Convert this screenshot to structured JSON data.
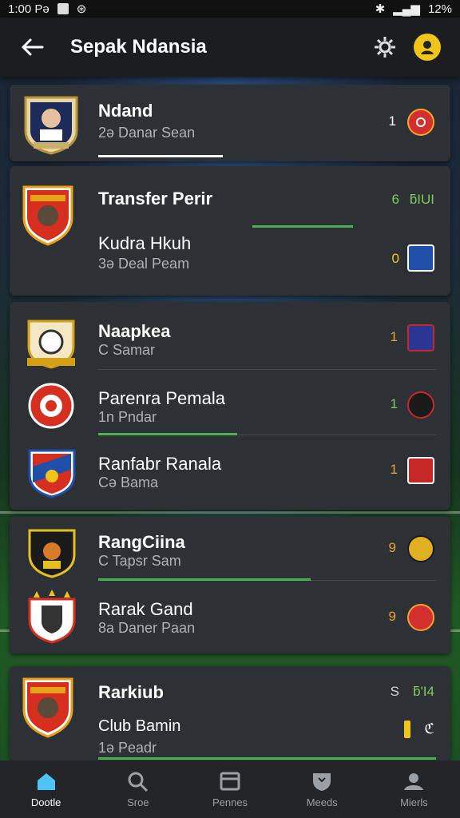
{
  "status": {
    "time": "1:00 Pǝ",
    "battery": "12%"
  },
  "header": {
    "title": "Sepak Ndansia"
  },
  "cards": [
    {
      "rows": [
        {
          "name": "Ndand",
          "sub": "2ə Danar Sean",
          "score": "1",
          "score_color": "#ffffff",
          "badge_color": "#d32f2f"
        }
      ]
    },
    {
      "rows": [
        {
          "name": "Transfer Perir",
          "sub": "",
          "score": "6",
          "score_color": "#7ecb5c",
          "extra": "ƃIUI",
          "badge_color": ""
        },
        {
          "name": "Kudra Hkuh",
          "sub": "3ə Deal Peam",
          "score": "0",
          "score_color": "#f0c419",
          "badge_color": "#1f4fa8"
        }
      ]
    },
    {
      "rows": [
        {
          "name": "Naapkea",
          "sub": "C Samar",
          "score": "1",
          "score_color": "#f0a030",
          "badge_color": "#283593"
        },
        {
          "name": "Parenra Pemala",
          "sub": "1n Pndar",
          "score": "1",
          "score_color": "#7ecb5c",
          "badge_color": "#1a1a1a"
        },
        {
          "name": "Ranfabr Ranala",
          "sub": "Cə Bama",
          "score": "1",
          "score_color": "#f0a030",
          "badge_color": "#c62828"
        }
      ]
    },
    {
      "rows": [
        {
          "name": "RangCiina",
          "sub": "C Tapsr Sam",
          "score": "9",
          "score_color": "#f0a030",
          "badge_color": "#e0b020"
        },
        {
          "name": "Rarak Gand",
          "sub": "8a Daner Paan",
          "score": "9",
          "score_color": "#f0a030",
          "badge_color": "#d32f2f"
        }
      ]
    },
    {
      "rows": [
        {
          "name": "Rarkiub",
          "sub": "",
          "score": "S",
          "score_color": "#cfd3d8",
          "extra": "ƃ'I4",
          "badge_color": ""
        },
        {
          "name": "Club Bamin",
          "sub": "1ə Peadr",
          "score": "",
          "score_color": "#fff",
          "badge_color": ""
        }
      ]
    }
  ],
  "nav": [
    {
      "label": "Dootle",
      "icon": "home-icon",
      "active": true
    },
    {
      "label": "Sroe",
      "icon": "search-icon",
      "active": false
    },
    {
      "label": "Pennes",
      "icon": "inbox-icon",
      "active": false
    },
    {
      "label": "Meeds",
      "icon": "heart-shield-icon",
      "active": false
    },
    {
      "label": "Mierls",
      "icon": "people-icon",
      "active": false
    }
  ]
}
